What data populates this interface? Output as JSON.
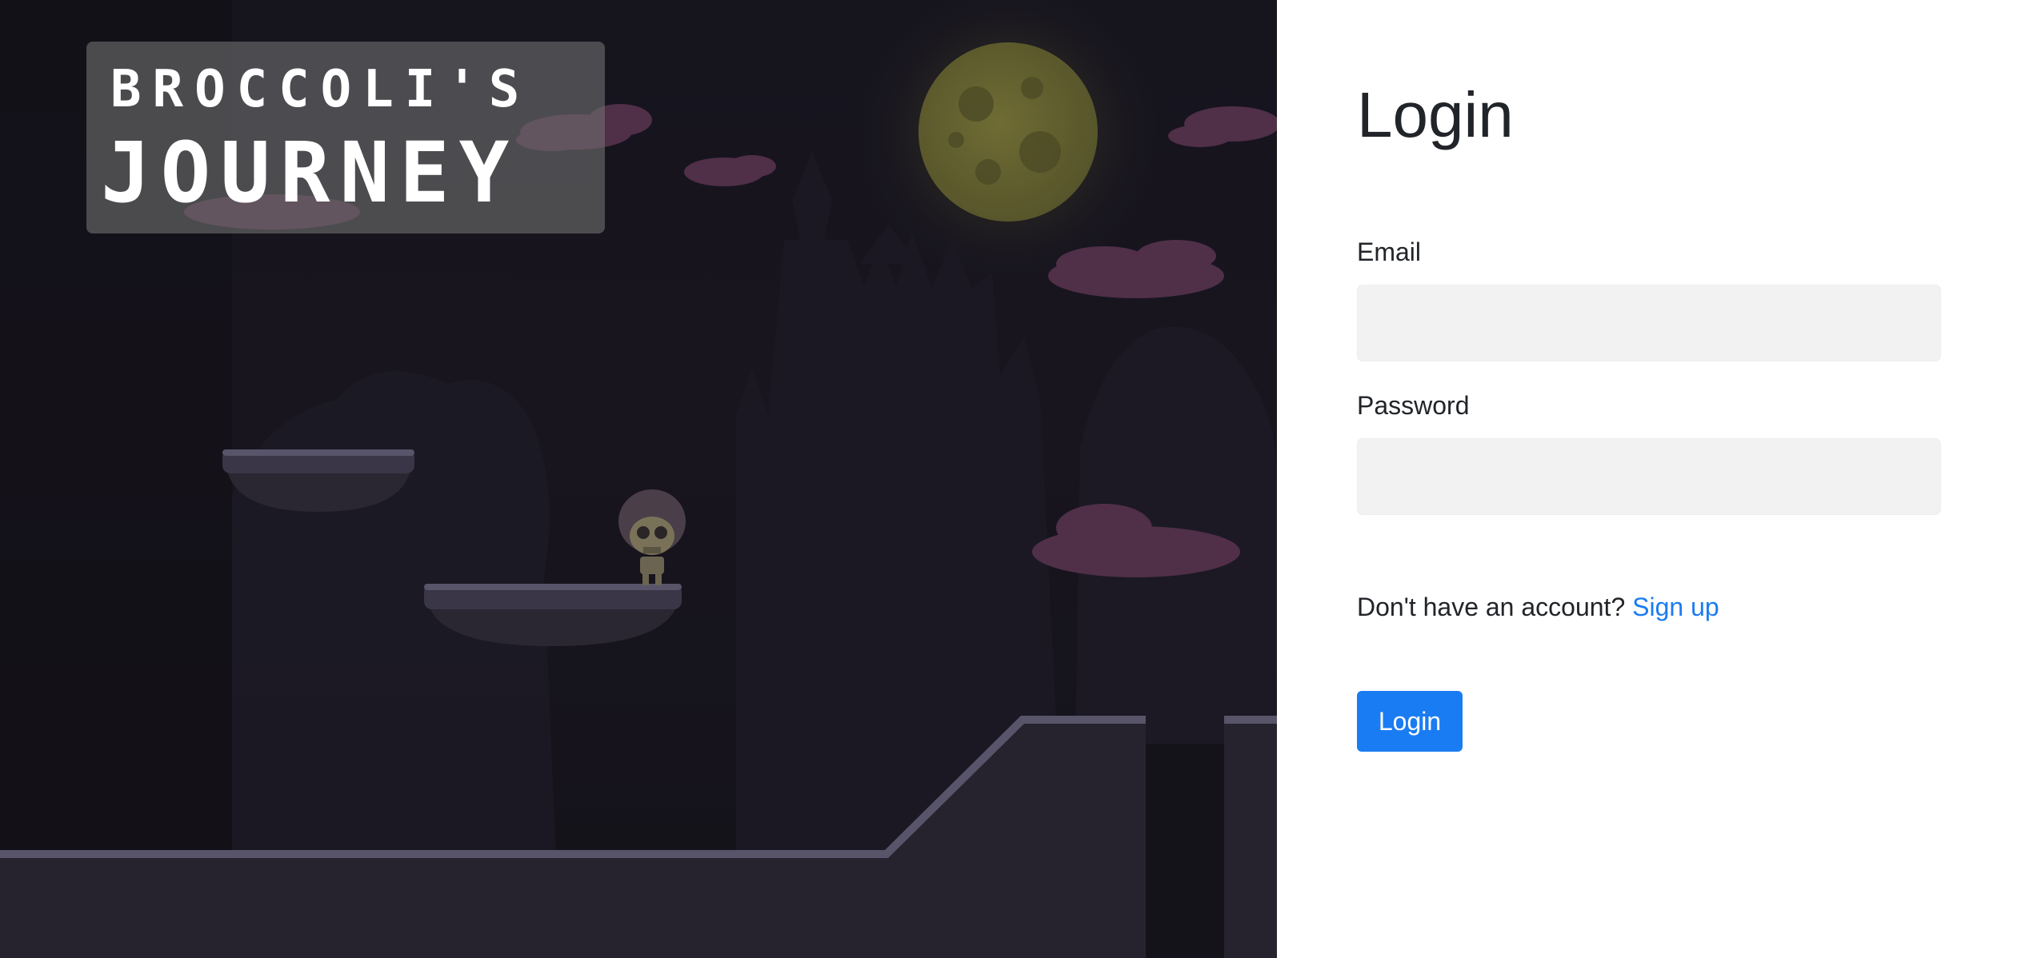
{
  "game": {
    "logo_line1": "BROCCOLI'S",
    "logo_line2": "JOURNEY"
  },
  "login": {
    "title": "Login",
    "email_label": "Email",
    "email_value": "",
    "password_label": "Password",
    "password_value": "",
    "signup_prompt": "Don't have an account?",
    "signup_link": "Sign up",
    "submit_label": "Login"
  },
  "colors": {
    "primary": "#1a7cf2",
    "input_bg": "#f2f2f2",
    "scene_bg": "#16141d",
    "text": "#212529"
  }
}
